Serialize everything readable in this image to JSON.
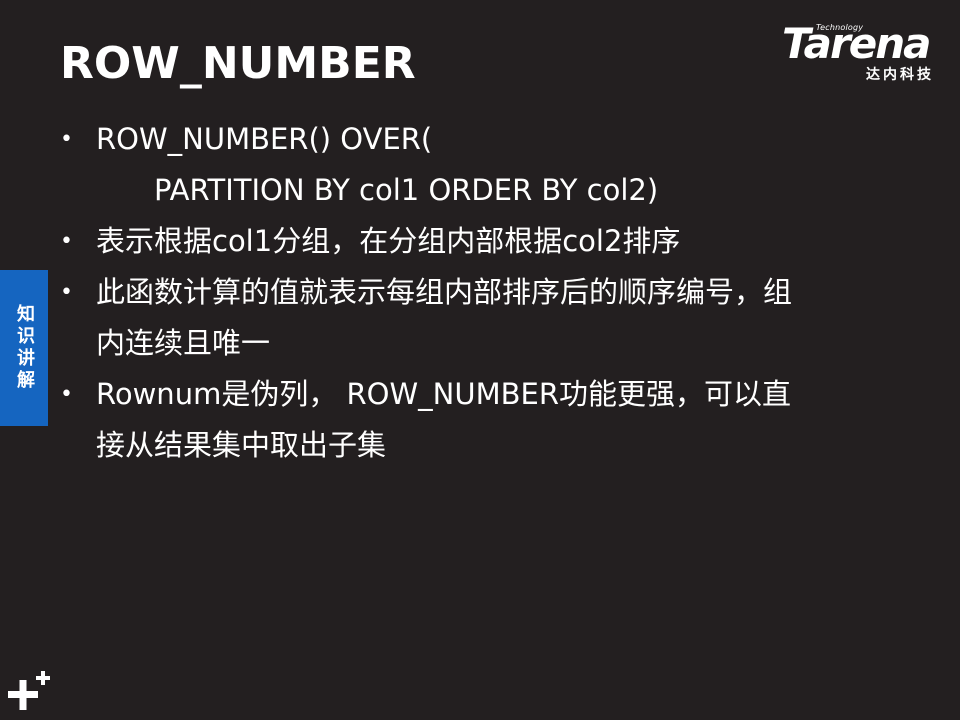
{
  "slide": {
    "title": "ROW_NUMBER",
    "side_tab": "知识讲解",
    "logo": {
      "tagline": "Technology",
      "wordmark": "Tarena",
      "chinese": "达内科技"
    },
    "bullets": [
      {
        "lines": [
          "ROW_NUMBER() OVER("
        ],
        "continuation": "PARTITION BY col1 ORDER BY col2)"
      },
      {
        "lines": [
          "表示根据col1分组，在分组内部根据col2排序"
        ]
      },
      {
        "lines": [
          "此函数计算的值就表示每组内部排序后的顺序编号，组",
          "内连续且唯一"
        ]
      },
      {
        "lines": [
          "Rownum是伪列， ROW_NUMBER功能更强，可以直",
          "接从结果集中取出子集"
        ]
      }
    ],
    "colors": {
      "background": "#231f20",
      "text": "#ffffff",
      "side_tab": "#1565c0"
    }
  }
}
